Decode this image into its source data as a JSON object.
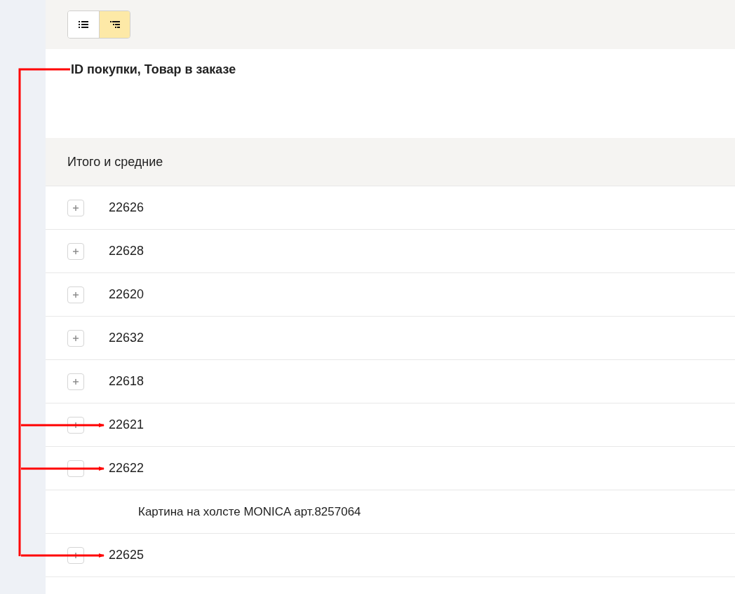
{
  "toolbar": {
    "view_buttons": [
      {
        "kind": "list",
        "selected": false
      },
      {
        "kind": "tree",
        "selected": true
      }
    ]
  },
  "header": {
    "title": "ID покупки, Товар в заказе"
  },
  "totals": {
    "label": "Итого и средние"
  },
  "rows": [
    {
      "label": "22626",
      "expanded": false,
      "arrow": false
    },
    {
      "label": "22628",
      "expanded": false,
      "arrow": false
    },
    {
      "label": "22620",
      "expanded": false,
      "arrow": false
    },
    {
      "label": "22632",
      "expanded": false,
      "arrow": false
    },
    {
      "label": "22618",
      "expanded": false,
      "arrow": false
    },
    {
      "label": "22621",
      "expanded": false,
      "arrow": true
    },
    {
      "label": "22622",
      "expanded": true,
      "arrow": true,
      "children": [
        {
          "label": "Картина на холсте MONICA арт.8257064"
        }
      ]
    },
    {
      "label": "22625",
      "expanded": false,
      "arrow": true
    }
  ]
}
